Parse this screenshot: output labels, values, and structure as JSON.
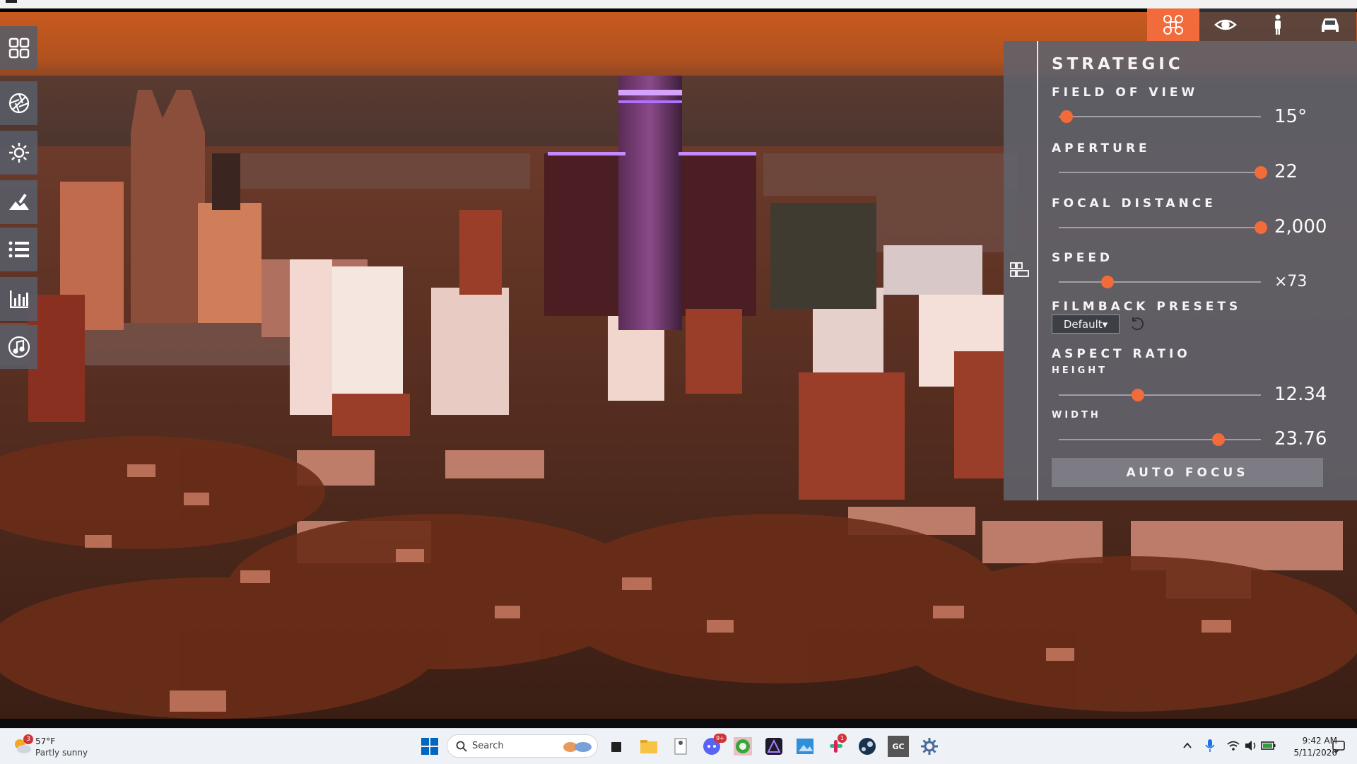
{
  "colors": {
    "accent": "#f26b3a",
    "panel_bg": "#60626a",
    "rail_bg": "#585c68",
    "sky": "#c45a22",
    "tower_glow": "#b070ff"
  },
  "rail": {
    "items": [
      {
        "icon": "grid-icon"
      },
      {
        "icon": "aperture-icon"
      },
      {
        "icon": "sun-icon"
      },
      {
        "icon": "terrain-brush-icon"
      },
      {
        "icon": "list-icon"
      },
      {
        "icon": "bar-chart-icon"
      },
      {
        "icon": "music-note-icon"
      }
    ]
  },
  "mode_tabs": [
    {
      "icon": "drone-icon",
      "active": true
    },
    {
      "icon": "eye-icon",
      "active": false
    },
    {
      "icon": "person-icon",
      "active": false
    },
    {
      "icon": "car-icon",
      "active": false
    }
  ],
  "panel": {
    "title": "STRATEGIC",
    "field_of_view": {
      "label": "FIELD OF VIEW",
      "value": "15°",
      "position": 0.04
    },
    "aperture": {
      "label": "APERTURE",
      "value": "22",
      "position": 1.0
    },
    "focal_distance": {
      "label": "FOCAL DISTANCE",
      "value": "2,000",
      "position": 1.0
    },
    "speed": {
      "label": "SPEED",
      "value": "×73",
      "position": 0.24
    },
    "filmback": {
      "label": "FILMBACK PRESETS",
      "selected": "Default▾"
    },
    "aspect_ratio": {
      "label": "ASPECT RATIO",
      "height": {
        "label": "HEIGHT",
        "value": "12.34",
        "position": 0.39
      },
      "width": {
        "label": "WIDTH",
        "value": "23.76",
        "position": 0.79
      }
    },
    "auto_focus_label": "AUTO FOCUS"
  },
  "taskbar": {
    "weather_temp": "57°F",
    "weather_desc": "Partly sunny",
    "weather_badge": "3",
    "search_label": "Search",
    "discord_badge": "9+",
    "slack_badge": "1",
    "time": "9:42 AM",
    "date": "5/11/2026",
    "app_icons": [
      "task-view-icon",
      "file-explorer-icon",
      "notepad-icon",
      "discord-icon",
      "green-app-icon",
      "affinity-icon",
      "photos-icon",
      "slack-icon",
      "steam-icon",
      "gc-app-icon",
      "settings-icon"
    ],
    "gc_label": "GC"
  }
}
